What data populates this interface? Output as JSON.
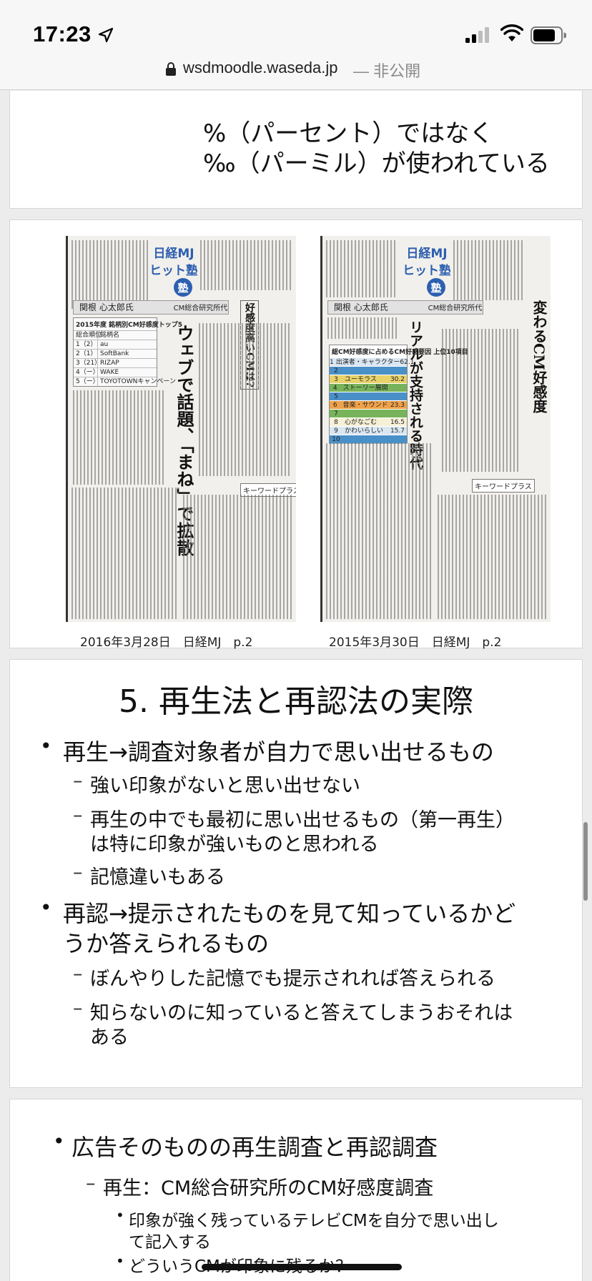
{
  "status_bar": {
    "time": "17:23",
    "location_icon": "location-arrow-icon",
    "signal_icon": "cellular-signal-icon",
    "wifi_icon": "wifi-icon",
    "battery_icon": "battery-icon"
  },
  "url_bar": {
    "lock_icon": "lock-icon",
    "host": "wsdmoodle.waseda.jp",
    "suffix": "— 非公開"
  },
  "slide1": {
    "line1": "%（パーセント）ではなく",
    "line2": "‰（パーミル）が使われている"
  },
  "slide2": {
    "left_paper": {
      "logo_line1": "日経MJ",
      "logo_line2": "ヒット塾",
      "author": "関根 心太郎氏",
      "org": "CM総合研究所代表",
      "headline_box": "好感度高いCMは?",
      "headline_main": "ウェブで話題、「まね」で拡散",
      "table_title": "2015年度 銘柄別CM好感度トップ5",
      "table_header": [
        "総合順位",
        "銘柄名"
      ],
      "table_rows": [
        [
          "1（2）",
          "au"
        ],
        [
          "2（1）",
          "SoftBank"
        ],
        [
          "3（21）",
          "RIZAP"
        ],
        [
          "4（ー）",
          "WAKE"
        ],
        [
          "5（ー）",
          "TOYOTOWNキャンペーン"
        ]
      ],
      "keyword": "キーワードプラス",
      "caption": "2016年3月28日　日経MJ　p.2"
    },
    "right_paper": {
      "logo_line1": "日経MJ",
      "logo_line2": "ヒット塾",
      "author": "関根 心太郎氏",
      "org": "CM総合研究所代表",
      "headline_box": "変わるCM好感度",
      "headline_main": "リアルが支持される時代",
      "table_title": "総CM好感度に占めるCM好感要因 上位10項目",
      "table_rows": [
        {
          "rank": "1",
          "name": "出演者・キャラクター",
          "value": "62.1"
        },
        {
          "rank": "2",
          "name": "",
          "value": ""
        },
        {
          "rank": "3",
          "name": "ユーモラス",
          "value": "30.2"
        },
        {
          "rank": "4",
          "name": "ストーリー展開",
          "value": ""
        },
        {
          "rank": "5",
          "name": "",
          "value": ""
        },
        {
          "rank": "6",
          "name": "音楽・サウンド",
          "value": "23.3"
        },
        {
          "rank": "7",
          "name": "",
          "value": ""
        },
        {
          "rank": "8",
          "name": "心がなごむ",
          "value": "16.5"
        },
        {
          "rank": "9",
          "name": "かわいらしい",
          "value": "15.7"
        },
        {
          "rank": "10",
          "name": "",
          "value": ""
        }
      ],
      "keyword": "キーワードプラス",
      "caption": "2015年3月30日　日経MJ　p.2"
    }
  },
  "slide3": {
    "title": "5. 再生法と再認法の実際",
    "bullets": [
      {
        "text": "再生→調査対象者が自力で思い出せるもの",
        "subs": [
          [
            "強い印象がないと思い出せない"
          ],
          [
            "再生の中でも最初に思い出せるもの（第一再生）",
            "は特に印象が強いものと思われる"
          ],
          [
            "記憶違いもある"
          ]
        ]
      },
      {
        "text": "再認→提示されたものを見て知っているかど",
        "text2": "うか答えられるもの",
        "subs": [
          [
            "ぼんやりした記憶でも提示されれば答えられる"
          ],
          [
            "知らないのに知っていると答えてしまうおそれは",
            "ある"
          ]
        ]
      }
    ]
  },
  "slide4": {
    "bullet": "広告そのものの再生調査と再認調査",
    "sub": "再生：CM総合研究所のCM好感度調査",
    "subsubs": [
      [
        "印象が強く残っているテレビCMを自分で思い出し",
        "て記入する"
      ],
      [
        "どういうCMが印象に残るか？"
      ]
    ]
  },
  "colors": {
    "table_blue": "#4a90c8",
    "table_orange": "#f0a24a",
    "table_green": "#77b35a",
    "table_yellow": "#e8d26a"
  }
}
